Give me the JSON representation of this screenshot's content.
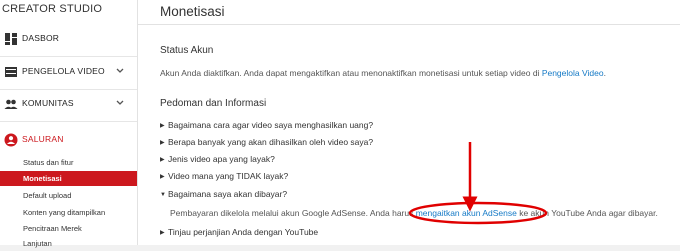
{
  "sidebar": {
    "studio_title": "CREATOR STUDIO",
    "items": [
      {
        "label": "DASBOR",
        "icon": "dashboard-icon"
      },
      {
        "label": "PENGELOLA VIDEO",
        "icon": "video-manager-icon"
      },
      {
        "label": "KOMUNITAS",
        "icon": "community-icon"
      },
      {
        "label": "SALURAN",
        "icon": "channel-icon"
      }
    ],
    "sub_items": [
      {
        "label": "Status dan fitur"
      },
      {
        "label": "Monetisasi"
      },
      {
        "label": "Default upload"
      },
      {
        "label": "Konten yang ditampilkan"
      },
      {
        "label": "Pencitraan Merek"
      },
      {
        "label": "Lanjutan"
      }
    ]
  },
  "header": {
    "title": "Monetisasi"
  },
  "account_status": {
    "heading": "Status Akun",
    "text": "Akun Anda diaktifkan. Anda dapat mengaktifkan atau menonaktifkan monetisasi untuk setiap video di ",
    "link": "Pengelola Video",
    "suffix": "."
  },
  "guidelines": {
    "heading": "Pedoman dan Informasi",
    "faqs": [
      {
        "label": "Bagaimana cara agar video saya menghasilkan uang?"
      },
      {
        "label": "Berapa banyak yang akan dihasilkan oleh video saya?"
      },
      {
        "label": "Jenis video apa yang layak?"
      },
      {
        "label": "Video mana yang TIDAK layak?"
      },
      {
        "label": "Bagaimana saya akan dibayar?"
      },
      {
        "label": "Tinjau perjanjian Anda dengan YouTube"
      }
    ],
    "answer_prefix": "Pembayaran dikelola melalui akun Google AdSense. Anda harus ",
    "answer_link": "mengaitkan akun AdSense",
    "answer_suffix": " ke akun YouTube Anda agar dibayar."
  },
  "colors": {
    "accent": "#cc181e",
    "link": "#167ac6"
  }
}
